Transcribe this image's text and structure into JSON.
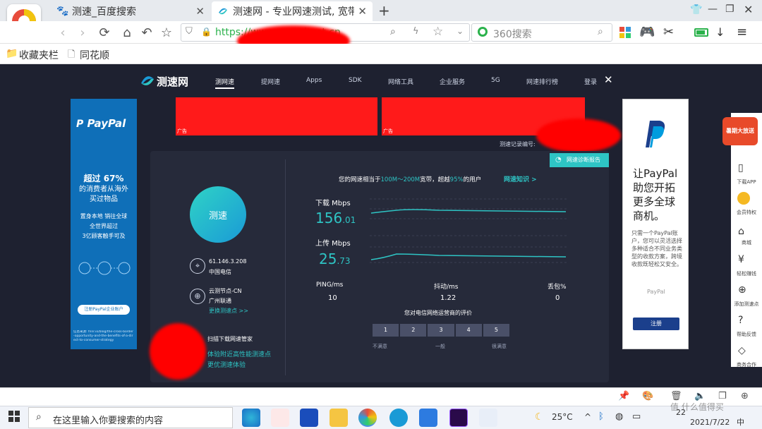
{
  "browser": {
    "tabs": [
      {
        "label": "测速_百度搜索"
      },
      {
        "label": "测速网 - 专业网速测试, 宽带"
      }
    ],
    "new_tab": "+",
    "url": "https://www.speedtest.cn",
    "search_engine": "360搜索",
    "bookmarks": [
      {
        "label": "收藏夹栏"
      },
      {
        "label": "同花顺"
      }
    ]
  },
  "site": {
    "logo": "测速网",
    "nav": [
      {
        "label": "测网速"
      },
      {
        "label": "提网速"
      },
      {
        "label": "Apps"
      },
      {
        "label": "SDK"
      },
      {
        "label": "网络工具"
      },
      {
        "label": "企业服务"
      },
      {
        "label": "5G"
      },
      {
        "label": "网速排行榜"
      },
      {
        "label": "登录"
      }
    ],
    "close": "✕"
  },
  "ads": {
    "banner_tag": "广告",
    "left": {
      "brand": "PayPal",
      "headline1": "超过 67%",
      "headline2": "的消费者从海外",
      "headline3": "买过物品",
      "body1": "置身本地 销往全球",
      "body2": "全世界超过",
      "body3": "3亿顾客触手可及",
      "cta": "注册PayPal企业账户",
      "fine": "信息来源: fnnr.io/blog/the-cross-border-opportunity-and-the-benefits-of-a-direct-to-consumer-strategy"
    },
    "right": {
      "headline1": "让PayPal",
      "headline2": "助您开拓",
      "headline3": "更多全球",
      "headline4": "商机。",
      "body": "只需一个PayPal账户，您可以灵活选择多种适合不同业务类型的收款方案，跨境收款既轻松又安全。",
      "brand": "PayPal",
      "cta": "注册"
    }
  },
  "result": {
    "record_label": "测速记录编号:",
    "diag_button": "网速诊断报告",
    "start_button": "测速",
    "ip": "61.146.3.208",
    "isp": "中国电信",
    "node": "云测节点-CN",
    "node_isp": "广州联通",
    "change_node": "更换测速点 >>",
    "qr_title": "扫描下载网速管家",
    "qr_line1": "体验附近高性能测速点",
    "qr_line2": "更优测速体验",
    "summary_pre": "您的网速相当于",
    "summary_range": "100M～200M",
    "summary_mid": "宽带，超越",
    "summary_pct": "95%",
    "summary_post": "的用户",
    "knowledge": "网速知识 >",
    "download_label": "下载 Mbps",
    "download_value": "156",
    "download_decimal": ".01",
    "upload_label": "上传 Mbps",
    "upload_value": "25",
    "upload_decimal": ".73",
    "ping_label": "PING/ms",
    "ping_value": "10",
    "jitter_label": "抖动/ms",
    "jitter_value": "1.22",
    "loss_label": "丢包%",
    "loss_value": "0",
    "rating_title": "您对电信网络运营商的评价",
    "ratings": [
      "1",
      "2",
      "3",
      "4",
      "5"
    ],
    "rating_low": "不满意",
    "rating_mid": "一般",
    "rating_high": "很满意"
  },
  "rail": [
    {
      "label": "暑期大放送"
    },
    {
      "label": "下载APP"
    },
    {
      "label": "会员特权"
    },
    {
      "label": "商城"
    },
    {
      "label": "轻松赚钱"
    },
    {
      "label": "添加测速点"
    },
    {
      "label": "帮助反馈"
    },
    {
      "label": "商务合作"
    }
  ],
  "taskbar": {
    "search_placeholder": "在这里输入你要搜索的内容",
    "temperature": "25°C",
    "time": "22",
    "date": "2021/7/22",
    "ime": "中",
    "watermark": "值 什么值得买"
  },
  "colors": {
    "accent": "#2ec4c4",
    "page_bg": "#1e2130",
    "panel_bg": "#262a3a"
  }
}
